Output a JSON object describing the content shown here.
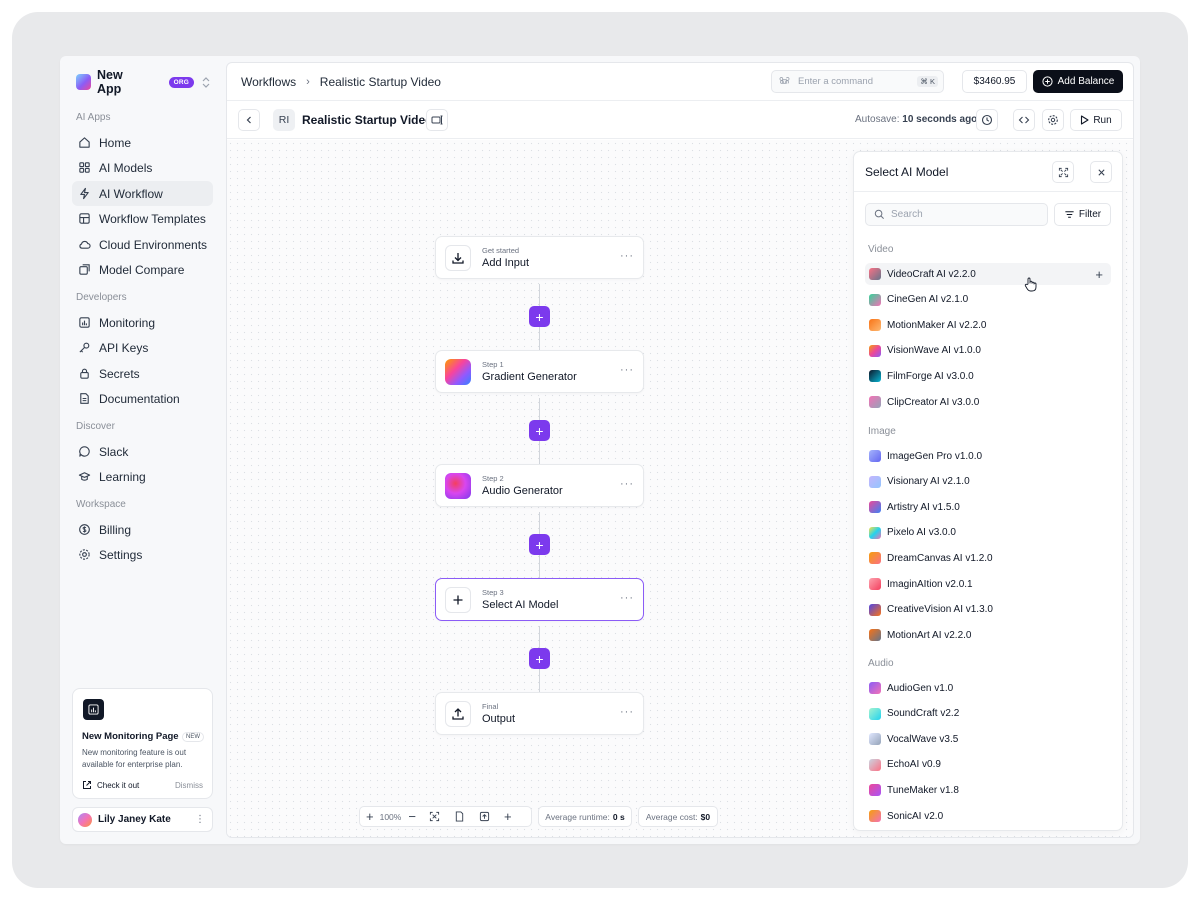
{
  "brand": {
    "name": "New App",
    "badge": "ORG"
  },
  "sidebar": {
    "sections": [
      {
        "label": "AI Apps",
        "items": [
          {
            "label": "Home",
            "icon": "home-icon"
          },
          {
            "label": "AI Models",
            "icon": "grid-icon"
          },
          {
            "label": "AI Workflow",
            "icon": "bolt-icon",
            "active": true
          },
          {
            "label": "Workflow Templates",
            "icon": "layout-icon"
          },
          {
            "label": "Cloud Environments",
            "icon": "cloud-icon"
          },
          {
            "label": "Model Compare",
            "icon": "compare-icon"
          }
        ]
      },
      {
        "label": "Developers",
        "items": [
          {
            "label": "Monitoring",
            "icon": "chart-icon"
          },
          {
            "label": "API Keys",
            "icon": "key-icon"
          },
          {
            "label": "Secrets",
            "icon": "lock-icon"
          },
          {
            "label": "Documentation",
            "icon": "file-icon"
          }
        ]
      },
      {
        "label": "Discover",
        "items": [
          {
            "label": "Slack",
            "icon": "chat-icon"
          },
          {
            "label": "Learning",
            "icon": "graduation-cap-icon"
          }
        ]
      },
      {
        "label": "Workspace",
        "items": [
          {
            "label": "Billing",
            "icon": "dollar-icon"
          },
          {
            "label": "Settings",
            "icon": "gear-icon"
          }
        ]
      }
    ],
    "promo": {
      "title": "New Monitoring Page",
      "badge": "NEW",
      "description": "New monitoring feature is out available for enterprise plan.",
      "cta": "Check it out",
      "dismiss": "Dismiss"
    },
    "user": {
      "name": "Lily Janey Kate"
    }
  },
  "topbar": {
    "breadcrumb": [
      "Workflows",
      "Realistic Startup Video"
    ],
    "command_placeholder": "Enter a command",
    "command_shortcut": "⌘ K",
    "balance": "$3460.95",
    "add_balance": "Add Balance"
  },
  "toolbar": {
    "initials": "RI",
    "title": "Realistic Startup Video",
    "autosave_label": "Autosave:",
    "autosave_value": "10 seconds ago",
    "run": "Run"
  },
  "workflow": {
    "nodes": [
      {
        "sub": "Get started",
        "title": "Add Input"
      },
      {
        "sub": "Step 1",
        "title": "Gradient Generator"
      },
      {
        "sub": "Step 2",
        "title": "Audio Generator"
      },
      {
        "sub": "Step 3",
        "title": "Select AI Model"
      },
      {
        "sub": "Final",
        "title": "Output"
      }
    ],
    "more": "···",
    "plus": "+"
  },
  "canvas_footer": {
    "zoom": "100%",
    "runtime_label": "Average runtime:",
    "runtime_value": "0 s",
    "cost_label": "Average cost:",
    "cost_value": "$0"
  },
  "panel": {
    "title": "Select AI Model",
    "search_placeholder": "Search",
    "filter": "Filter",
    "groups": [
      {
        "label": "Video",
        "models": [
          {
            "name": "VideoCraft AI v2.2.0",
            "colors": [
              "#fb7185",
              "#64748b"
            ]
          },
          {
            "name": "CineGen AI v2.1.0",
            "colors": [
              "#34d399",
              "#f472b6"
            ]
          },
          {
            "name": "MotionMaker AI v2.2.0",
            "colors": [
              "#f97316",
              "#fdba74"
            ]
          },
          {
            "name": "VisionWave AI v1.0.0",
            "colors": [
              "#f59e0b",
              "#ec4899",
              "#8b5cf6"
            ]
          },
          {
            "name": "FilmForge AI v3.0.0",
            "colors": [
              "#0f172a",
              "#06b6d4"
            ]
          },
          {
            "name": "ClipCreator AI v3.0.0",
            "colors": [
              "#f472b6",
              "#94a3b8"
            ]
          }
        ]
      },
      {
        "label": "Image",
        "models": [
          {
            "name": "ImageGen Pro v1.0.0",
            "colors": [
              "#a5b4fc",
              "#6366f1"
            ]
          },
          {
            "name": "Visionary AI v2.1.0",
            "colors": [
              "#c4b5fd",
              "#93c5fd"
            ]
          },
          {
            "name": "Artistry AI v1.5.0",
            "colors": [
              "#ec4899",
              "#3b82f6"
            ]
          },
          {
            "name": "Pixelo AI v3.0.0",
            "colors": [
              "#fde047",
              "#22d3ee",
              "#f472b6"
            ]
          },
          {
            "name": "DreamCanvas AI v1.2.0",
            "colors": [
              "#f59e0b",
              "#fb7185"
            ]
          },
          {
            "name": "ImaginAItion v2.0.1",
            "colors": [
              "#fda4af",
              "#f43f5e"
            ]
          },
          {
            "name": "CreativeVision AI v1.3.0",
            "colors": [
              "#4f46e5",
              "#f97316"
            ]
          },
          {
            "name": "MotionArt AI v2.2.0",
            "colors": [
              "#f97316",
              "#64748b"
            ]
          }
        ]
      },
      {
        "label": "Audio",
        "models": [
          {
            "name": "AudioGen v1.0",
            "colors": [
              "#8b5cf6",
              "#f472b6"
            ]
          },
          {
            "name": "SoundCraft v2.2",
            "colors": [
              "#a7f3d0",
              "#22d3ee"
            ]
          },
          {
            "name": "VocalWave v3.5",
            "colors": [
              "#e0e7ff",
              "#94a3b8"
            ]
          },
          {
            "name": "EchoAI v0.9",
            "colors": [
              "#cbd5e1",
              "#fb7185"
            ]
          },
          {
            "name": "TuneMaker v1.8",
            "colors": [
              "#ec4899",
              "#a855f7"
            ]
          },
          {
            "name": "SonicAI v2.0",
            "colors": [
              "#f59e0b",
              "#f472b6"
            ]
          }
        ]
      }
    ]
  },
  "colors": {
    "accent": "#7c3aed",
    "dark_button": "#0b0f19"
  }
}
